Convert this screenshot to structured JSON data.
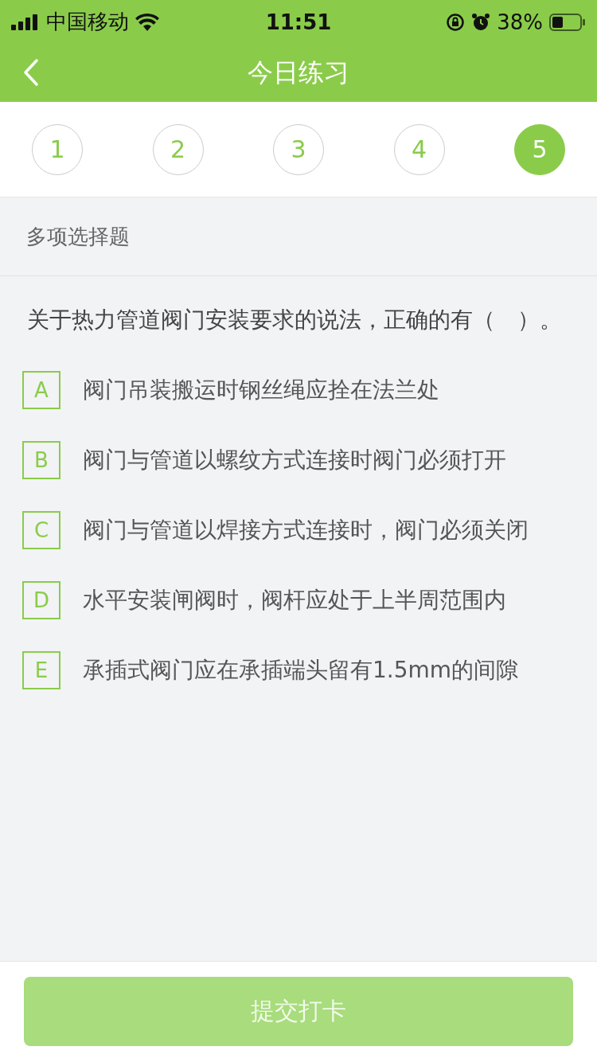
{
  "status_bar": {
    "carrier": "中国移动",
    "time": "11:51",
    "battery": "38%"
  },
  "nav": {
    "title": "今日练习"
  },
  "steps": [
    {
      "label": "1",
      "selected": false
    },
    {
      "label": "2",
      "selected": false
    },
    {
      "label": "3",
      "selected": false
    },
    {
      "label": "4",
      "selected": false
    },
    {
      "label": "5",
      "selected": true
    }
  ],
  "question_type": "多项选择题",
  "question": "关于热力管道阀门安装要求的说法，正确的有（　）。",
  "options": [
    {
      "letter": "A",
      "text": "阀门吊装搬运时钢丝绳应拴在法兰处",
      "selected": false
    },
    {
      "letter": "B",
      "text": "阀门与管道以螺纹方式连接时阀门必须打开",
      "selected": false
    },
    {
      "letter": "C",
      "text": "阀门与管道以焊接方式连接时，阀门必须关闭",
      "selected": false
    },
    {
      "letter": "D",
      "text": "水平安装闸阀时，阀杆应处于上半周范围内",
      "selected": false
    },
    {
      "letter": "E",
      "text": "承插式阀门应在承插端头留有1.5mm的间隙",
      "selected": false
    }
  ],
  "submit_button": "提交打卡"
}
